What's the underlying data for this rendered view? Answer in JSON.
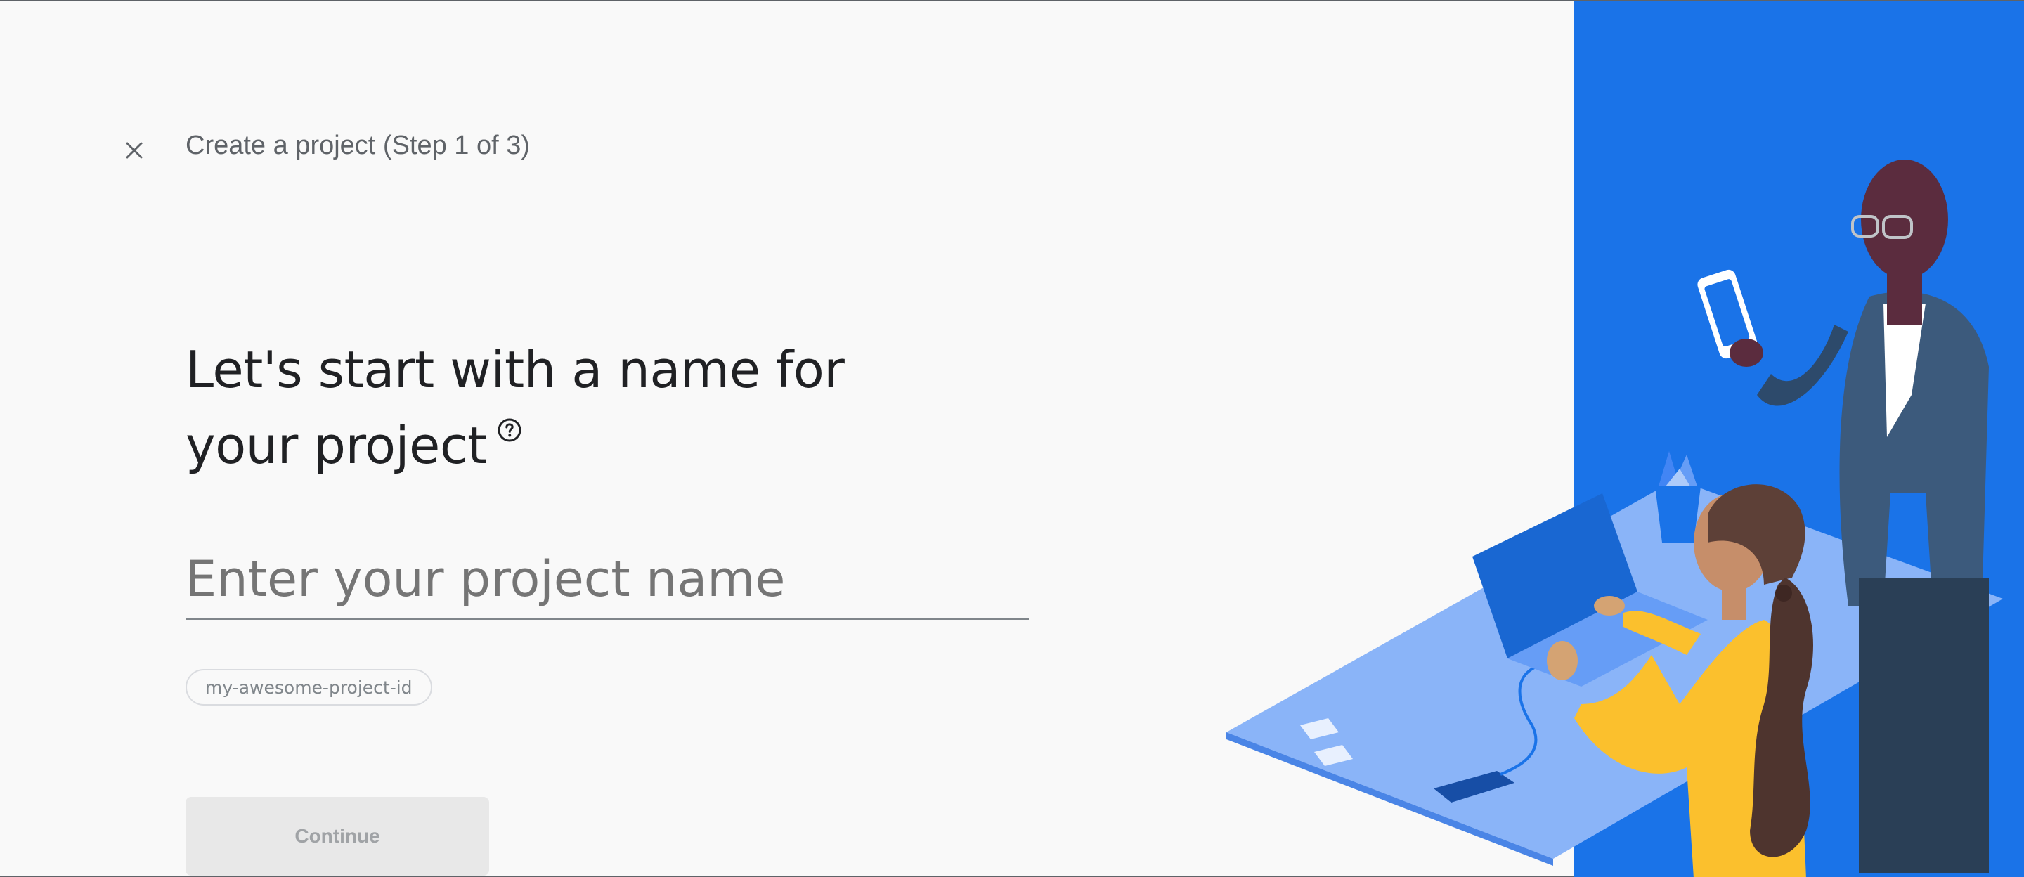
{
  "header": {
    "step_title": "Create a project (Step 1 of 3)",
    "close_icon": "close-icon"
  },
  "main": {
    "heading_line1": "Let's start with a name for",
    "heading_line2": "your project",
    "help_icon": "help-circle-icon",
    "name_input": {
      "value": "",
      "placeholder": "Enter your project name"
    },
    "project_id": "my-awesome-project-id",
    "continue_label": "Continue",
    "continue_enabled": false
  },
  "colors": {
    "accent_blue": "#1a73e8",
    "background": "#f9f9f9",
    "person_shirt_yellow": "#fbc02d",
    "hair_brown": "#4e342e"
  }
}
